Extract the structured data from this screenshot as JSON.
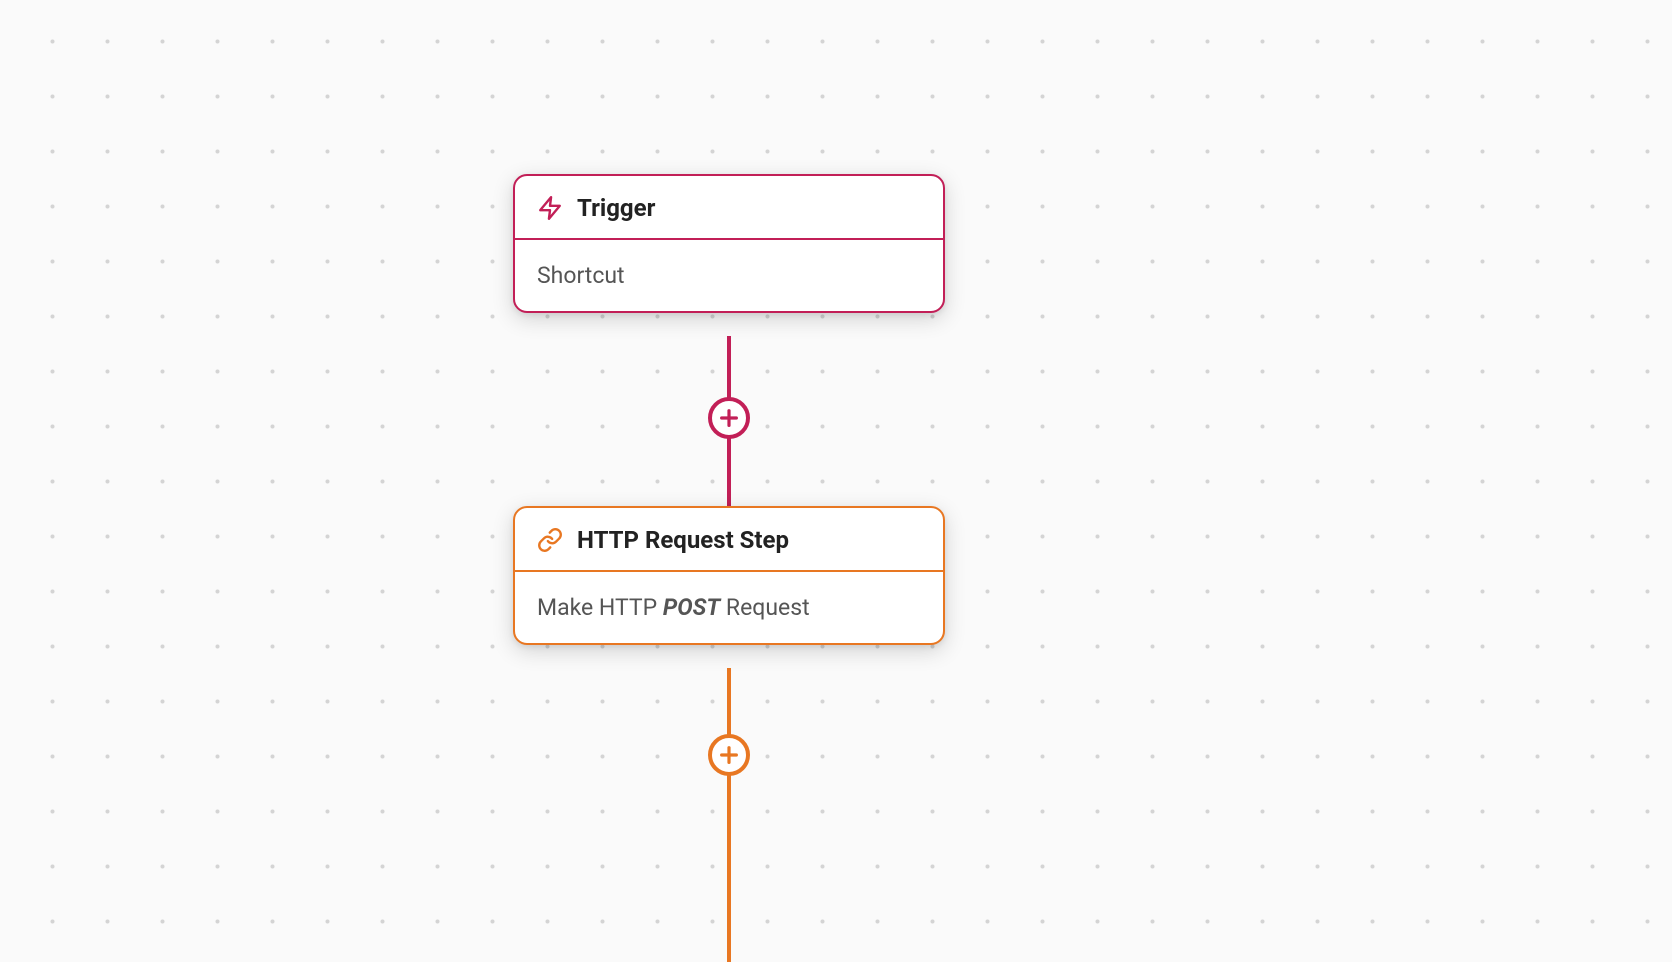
{
  "nodes": {
    "trigger": {
      "title": "Trigger",
      "body": "Shortcut",
      "icon": "lightning-icon",
      "accent": "#c21f57"
    },
    "http": {
      "title": "HTTP Request Step",
      "body_pre": "Make HTTP ",
      "body_emph": "POST",
      "body_post": " Request",
      "icon": "link-icon",
      "accent": "#e87722"
    }
  },
  "add_buttons": {
    "between": {
      "color": "#c21f57"
    },
    "after": {
      "color": "#e87722"
    }
  }
}
